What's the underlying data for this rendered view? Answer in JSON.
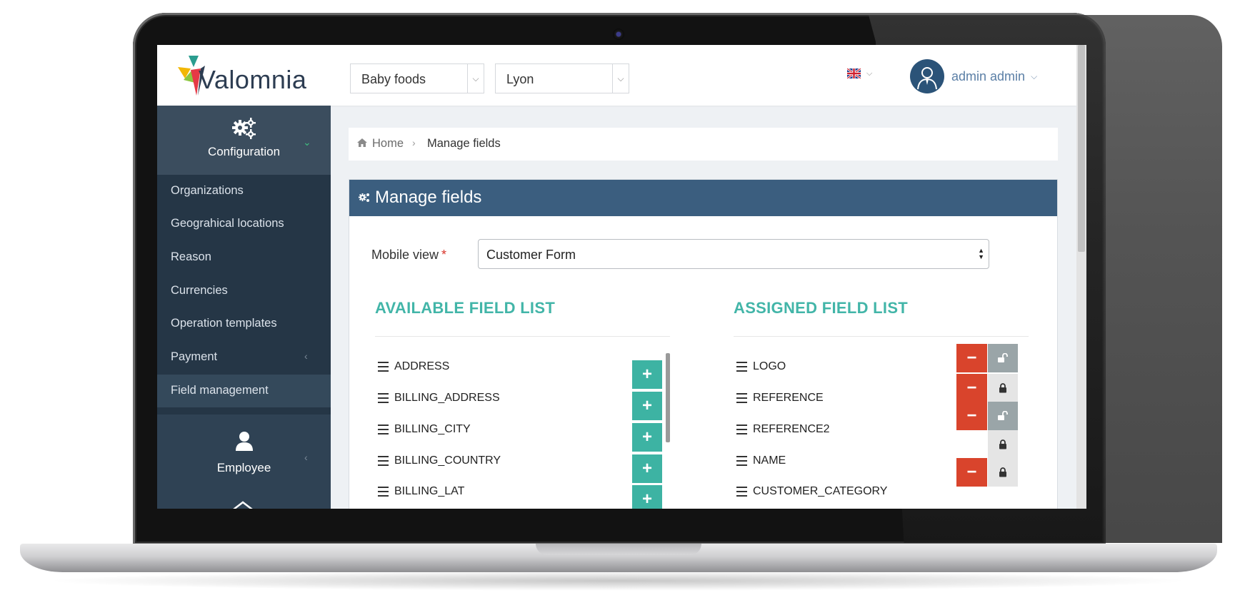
{
  "header": {
    "logo_text": "Valomnia",
    "category_select": "Baby foods",
    "city_select": "Lyon",
    "user_name": "admin admin"
  },
  "sidebar": {
    "section_label": "Configuration",
    "items": [
      {
        "label": "Organizations"
      },
      {
        "label": "Geograhical locations"
      },
      {
        "label": "Reason"
      },
      {
        "label": "Currencies"
      },
      {
        "label": "Operation templates"
      },
      {
        "label": "Payment"
      },
      {
        "label": "Field management"
      }
    ],
    "employee_label": "Employee"
  },
  "breadcrumb": {
    "home": "Home",
    "current": "Manage fields"
  },
  "panel": {
    "title": "Manage fields",
    "mobile_view_label": "Mobile view",
    "required_mark": "*",
    "mobile_view_value": "Customer Form",
    "available_title": "AVAILABLE FIELD LIST",
    "assigned_title": "ASSIGNED FIELD LIST",
    "available_fields": [
      "ADDRESS",
      "BILLING_ADDRESS",
      "BILLING_CITY",
      "BILLING_COUNTRY",
      "BILLING_LAT"
    ],
    "assigned_fields": [
      "LOGO",
      "REFERENCE",
      "REFERENCE2",
      "NAME",
      "CUSTOMER_CATEGORY"
    ]
  },
  "icons": {
    "add": "plus-icon",
    "remove": "minus-icon",
    "lock": "lock-icon",
    "unlock": "unlock-icon"
  },
  "colors": {
    "sidebar_bg": "#2f4254",
    "panel_header": "#3b5e7f",
    "accent_teal": "#3db3a3",
    "remove_red": "#d9442c"
  }
}
